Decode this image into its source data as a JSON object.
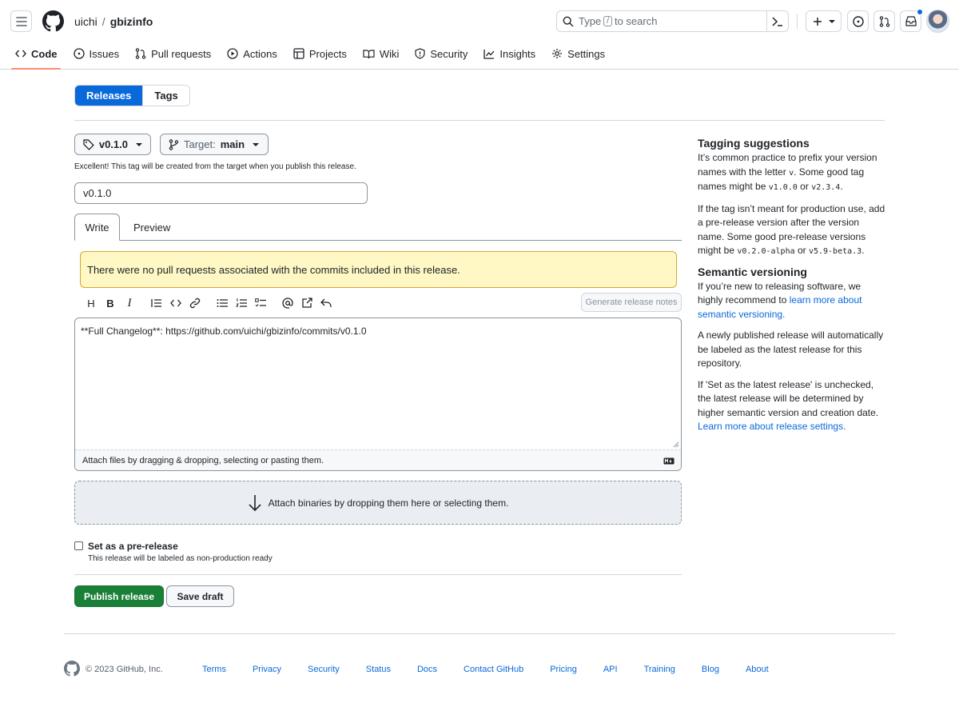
{
  "header": {
    "owner": "uichi",
    "separator": "/",
    "repo": "gbizinfo",
    "search": {
      "prefix": "Type",
      "key": "/",
      "suffix": "to search"
    },
    "nav": [
      {
        "label": "Code",
        "icon": "code-icon",
        "active": true
      },
      {
        "label": "Issues",
        "icon": "issue-icon"
      },
      {
        "label": "Pull requests",
        "icon": "pull-request-icon"
      },
      {
        "label": "Actions",
        "icon": "play-icon"
      },
      {
        "label": "Projects",
        "icon": "table-icon"
      },
      {
        "label": "Wiki",
        "icon": "book-icon"
      },
      {
        "label": "Security",
        "icon": "shield-icon"
      },
      {
        "label": "Insights",
        "icon": "graph-icon"
      },
      {
        "label": "Settings",
        "icon": "gear-icon"
      }
    ]
  },
  "toggle": {
    "releases": "Releases",
    "tags": "Tags"
  },
  "tag_picker": {
    "value": "v0.1.0"
  },
  "target_picker": {
    "label": "Target:",
    "value": "main"
  },
  "tag_hint": "Excellent! This tag will be created from the target when you publish this release.",
  "release_title": "v0.1.0",
  "editor_tabs": {
    "write": "Write",
    "preview": "Preview"
  },
  "flash": "There were no pull requests associated with the commits included in this release.",
  "generate_notes": "Generate release notes",
  "body_text": "**Full Changelog**: https://github.com/uichi/gbizinfo/commits/v0.1.0",
  "attach_hint": "Attach files by dragging & dropping, selecting or pasting them.",
  "binaries_hint": "Attach binaries by dropping them here or selecting them.",
  "prerelease": {
    "label": "Set as a pre-release",
    "desc": "This release will be labeled as non-production ready",
    "checked": false
  },
  "actions": {
    "publish": "Publish release",
    "draft": "Save draft"
  },
  "sidebar": {
    "tagging_title": "Tagging suggestions",
    "tagging_p1_a": "It’s common practice to prefix your version names with the letter ",
    "tagging_p1_code1": "v",
    "tagging_p1_b": ". Some good tag names might be ",
    "tagging_p1_code2": "v1.0.0",
    "tagging_p1_c": " or ",
    "tagging_p1_code3": "v2.3.4",
    "tagging_p1_d": ".",
    "tagging_p2_a": "If the tag isn’t meant for production use, add a pre-release version after the version name. Some good pre-release versions might be ",
    "tagging_p2_code1": "v0.2.0-alpha",
    "tagging_p2_b": " or ",
    "tagging_p2_code2": "v5.9-beta.3",
    "tagging_p2_c": ".",
    "semver_title": "Semantic versioning",
    "semver_p1_a": "If you’re new to releasing software, we highly recommend to ",
    "semver_p1_link": "learn more about semantic versioning.",
    "semver_p2": "A newly published release will automatically be labeled as the latest release for this repository.",
    "semver_p3": "If 'Set as the latest release' is unchecked, the latest release will be determined by higher semantic version and creation date.",
    "semver_p3_link": "Learn more about release settings."
  },
  "footer": {
    "copyright": "© 2023 GitHub, Inc.",
    "links": [
      "Terms",
      "Privacy",
      "Security",
      "Status",
      "Docs",
      "Contact GitHub",
      "Pricing",
      "API",
      "Training",
      "Blog",
      "About"
    ]
  },
  "colors": {
    "accent": "#0969da",
    "publish": "#1a7f37",
    "flash_bg": "#fff8c5",
    "nav_underline": "#fd8c73"
  }
}
